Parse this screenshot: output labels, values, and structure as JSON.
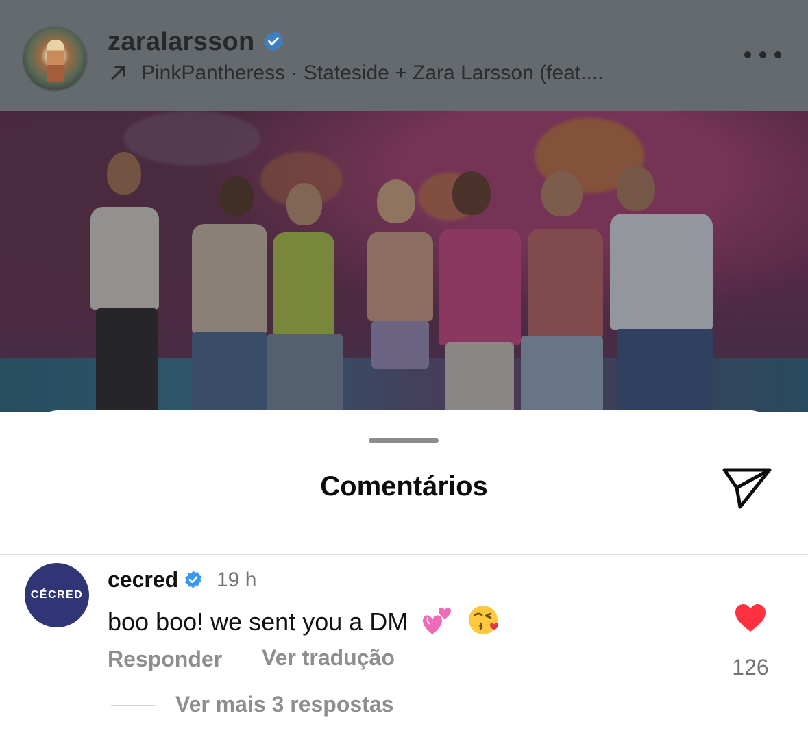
{
  "post": {
    "username": "zaralarsson",
    "verified": true,
    "audio_label": "PinkPantheress · Stateside + Zara Larsson (feat...."
  },
  "comments_sheet": {
    "title": "Comentários"
  },
  "comment": {
    "author": "cecred",
    "avatar_text": "CÉCRED",
    "verified": true,
    "time": "19 h",
    "text": "boo boo! we sent you a DM",
    "emojis": [
      "two-hearts",
      "face-blowing-kiss"
    ],
    "reply_label": "Responder",
    "translate_label": "Ver tradução",
    "like_count": "126",
    "liked": true,
    "view_replies_label": "Ver mais 3 respostas"
  },
  "colors": {
    "verified_blue": "#3897f0",
    "like_red": "#ff3040",
    "avatar_navy": "#2f3575",
    "overlay_gray": "#656a6e"
  },
  "icons": {
    "more": "more-horizontal-icon",
    "share": "paper-plane-icon",
    "audio": "arrow-up-right-icon",
    "like": "heart-filled-icon"
  }
}
